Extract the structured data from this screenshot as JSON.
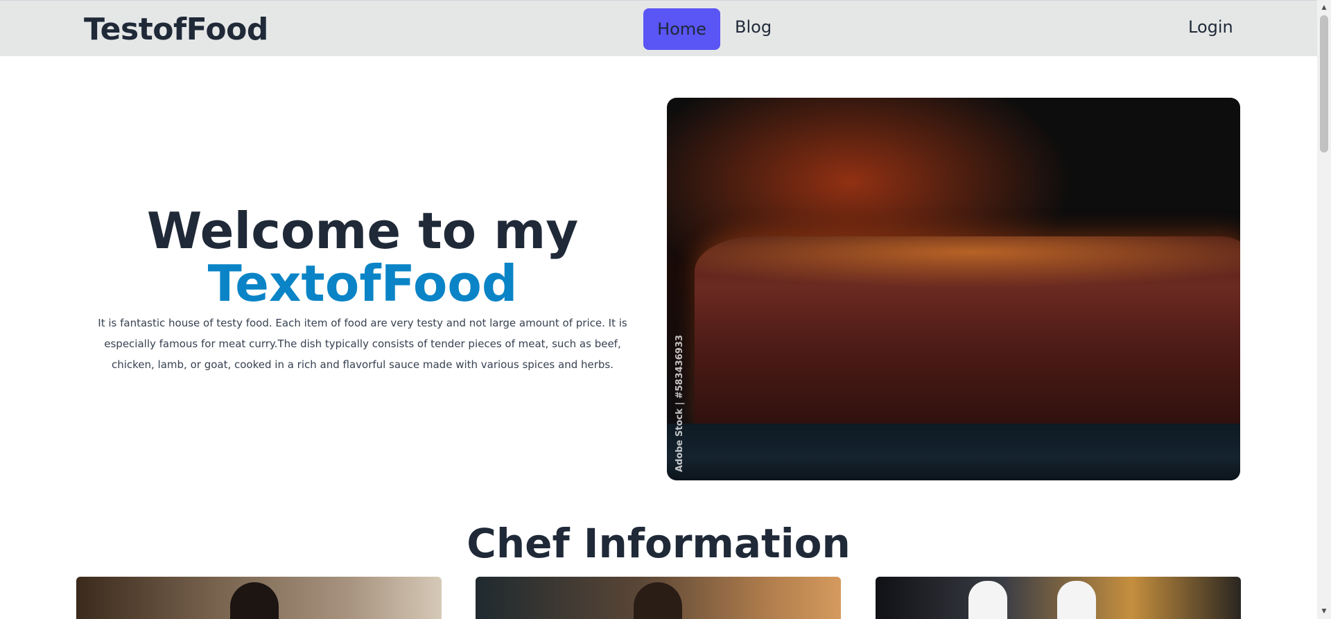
{
  "navbar": {
    "brand": "TestofFood",
    "links": [
      {
        "label": "Home",
        "active": true
      },
      {
        "label": "Blog",
        "active": false
      }
    ],
    "login": "Login",
    "active_color": "#5a55f5"
  },
  "hero": {
    "title_line1": "Welcome to my",
    "title_line2": "TextofFood",
    "description": "It is fantastic house of testy food. Each item of food are very testy and not large amount of price. It is especially famous for meat curry.The dish typically consists of tender pieces of meat, such as beef, chicken, lamb, or goat, cooked in a rich and flavorful sauce made with various spices and herbs.",
    "image_watermark": "Adobe Stock | #583436933",
    "brand_color": "#0a84c6"
  },
  "chefs": {
    "title": "Chef Information",
    "cards": [
      {
        "icon": "chef-photo"
      },
      {
        "icon": "chef-photo"
      },
      {
        "icon": "chef-photo"
      }
    ]
  },
  "scrollbar": {
    "up_icon": "▲",
    "down_icon": "▼"
  }
}
